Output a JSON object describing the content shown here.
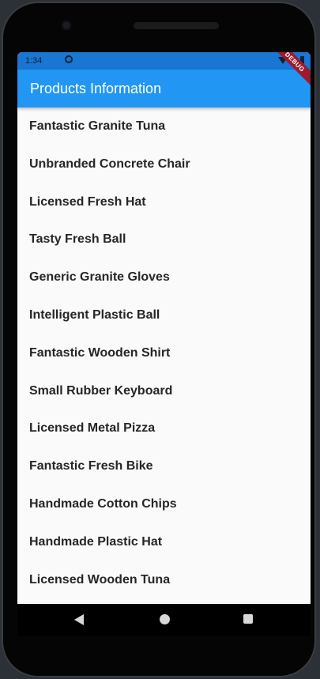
{
  "status_bar": {
    "time": "1:34"
  },
  "app_bar": {
    "title": "Products Information",
    "color": "#2196f3"
  },
  "debug_banner": "DEBUG",
  "products": [
    "Fantastic Granite Tuna",
    "Unbranded Concrete Chair",
    "Licensed Fresh Hat",
    "Tasty Fresh Ball",
    "Generic Granite Gloves",
    "Intelligent Plastic Ball",
    "Fantastic Wooden Shirt",
    "Small Rubber Keyboard",
    "Licensed Metal Pizza",
    "Fantastic Fresh Bike",
    "Handmade Cotton Chips",
    "Handmade Plastic Hat",
    "Licensed Wooden Tuna"
  ],
  "nav_bar": {
    "icons": [
      "back-icon",
      "home-icon",
      "recents-icon"
    ]
  }
}
